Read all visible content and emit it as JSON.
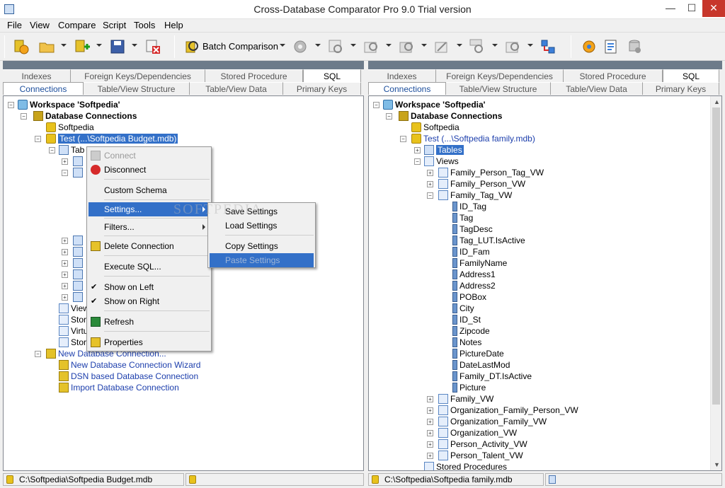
{
  "window": {
    "title": "Cross-Database Comparator Pro 9.0 Trial version",
    "min": "—",
    "max": "☐",
    "close": "✕"
  },
  "menu": [
    "File",
    "View",
    "Compare",
    "Script",
    "Tools",
    "Help"
  ],
  "toolbar": {
    "batch_label": "Batch Comparison"
  },
  "tabs": {
    "row1": [
      "Indexes",
      "Foreign Keys/Dependencies",
      "Stored Procedure",
      "SQL"
    ],
    "row2": [
      "Connections",
      "Table/View Structure",
      "Table/View Data",
      "Primary Keys"
    ]
  },
  "left_tree": {
    "workspace": "Workspace 'Softpedia'",
    "db_connections": "Database Connections",
    "conn1": "Softpedia",
    "conn2": "Test  (...\\Softpedia Budget.mdb)",
    "tables_stub": "Tab",
    "views_stub": "View",
    "stor_stub1": "Stor",
    "virt_stub": "Virtu",
    "stor_stub2": "Stor",
    "new_conn": "New Database Connection...",
    "wizard": "New Database Connection Wizard",
    "dsn": "DSN based Database Connection",
    "import": "Import Database Connection"
  },
  "right_tree": {
    "workspace": "Workspace 'Softpedia'",
    "db_connections": "Database Connections",
    "conn1": "Softpedia",
    "conn2": "Test  (...\\Softpedia family.mdb)",
    "tables": "Tables",
    "views": "Views",
    "view_items_top": [
      "Family_Person_Tag_VW",
      "Family_Person_VW",
      "Family_Tag_VW"
    ],
    "columns": [
      "ID_Tag",
      "Tag",
      "TagDesc",
      "Tag_LUT.IsActive",
      "ID_Fam",
      "FamilyName",
      "Address1",
      "Address2",
      "POBox",
      "City",
      "ID_St",
      "Zipcode",
      "Notes",
      "PictureDate",
      "DateLastMod",
      "Family_DT.IsActive",
      "Picture"
    ],
    "view_items_bottom": [
      "Family_VW",
      "Organization_Family_Person_VW",
      "Organization_Family_VW",
      "Organization_VW",
      "Person_Activity_VW",
      "Person_Talent_VW"
    ],
    "stored_procs": "Stored Procedures"
  },
  "context_menu": {
    "connect": "Connect",
    "disconnect": "Disconnect",
    "custom_schema": "Custom Schema",
    "settings": "Settings...",
    "filters": "Filters...",
    "delete": "Delete Connection",
    "exec_sql": "Execute SQL...",
    "show_left": "Show on Left",
    "show_right": "Show on Right",
    "refresh": "Refresh",
    "properties": "Properties",
    "check": "✔"
  },
  "submenu": {
    "save": "Save   Settings",
    "load": "Load   Settings",
    "copy": "Copy   Settings",
    "paste": "Paste   Settings"
  },
  "status": {
    "left_path": "C:\\Softpedia\\Softpedia Budget.mdb",
    "right_path": "C:\\Softpedia\\Softpedia family.mdb"
  },
  "watermark": "SOFTPEDIA",
  "colors": {
    "selection": "#3370c8",
    "header": "#6d7b8a",
    "link": "#1c3eac",
    "close": "#c7362b"
  }
}
